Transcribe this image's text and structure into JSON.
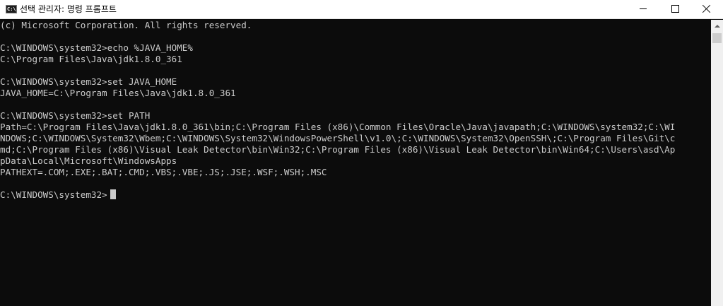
{
  "window": {
    "title": "선택 관리자: 명령 프롬프트",
    "app_icon_text": "C:\\",
    "app_icon_name": "cmd-icon",
    "controls": {
      "minimize_icon": "minimize-icon",
      "maximize_icon": "maximize-icon",
      "close_icon": "close-icon"
    }
  },
  "console": {
    "lines": [
      "(c) Microsoft Corporation. All rights reserved.",
      "",
      "C:\\WINDOWS\\system32>echo %JAVA_HOME%",
      "C:\\Program Files\\Java\\jdk1.8.0_361",
      "",
      "C:\\WINDOWS\\system32>set JAVA_HOME",
      "JAVA_HOME=C:\\Program Files\\Java\\jdk1.8.0_361",
      "",
      "C:\\WINDOWS\\system32>set PATH",
      "Path=C:\\Program Files\\Java\\jdk1.8.0_361\\bin;C:\\Program Files (x86)\\Common Files\\Oracle\\Java\\javapath;C:\\WINDOWS\\system32;C:\\WI",
      "NDOWS;C:\\WINDOWS\\System32\\Wbem;C:\\WINDOWS\\System32\\WindowsPowerShell\\v1.0\\;C:\\WINDOWS\\System32\\OpenSSH\\;C:\\Program Files\\Git\\c",
      "md;C:\\Program Files (x86)\\Visual Leak Detector\\bin\\Win32;C:\\Program Files (x86)\\Visual Leak Detector\\bin\\Win64;C:\\Users\\asd\\Ap",
      "pData\\Local\\Microsoft\\WindowsApps",
      "PATHEXT=.COM;.EXE;.BAT;.CMD;.VBS;.VBE;.JS;.JSE;.WSF;.WSH;.MSC",
      ""
    ],
    "prompt": "C:\\WINDOWS\\system32>"
  },
  "colors": {
    "background": "#0c0c0c",
    "foreground": "#cccccc",
    "titlebar": "#ffffff"
  }
}
